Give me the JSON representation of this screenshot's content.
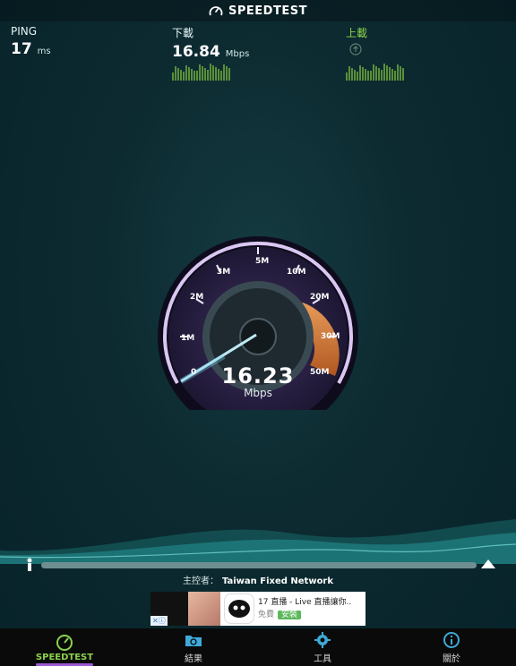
{
  "header": {
    "title": "SPEEDTEST"
  },
  "stats": {
    "ping": {
      "label": "PING",
      "value": "17",
      "unit": "ms"
    },
    "download": {
      "label": "下載",
      "value": "16.84",
      "unit": "Mbps"
    },
    "upload": {
      "label": "上載"
    }
  },
  "gauge": {
    "ticks": [
      "0",
      "1M",
      "2M",
      "3M",
      "5M",
      "10M",
      "20M",
      "30M",
      "50M"
    ],
    "value": "16.23",
    "unit": "Mbps"
  },
  "host": {
    "label": "主控者：",
    "name": "Taiwan Fixed Network"
  },
  "ad": {
    "title": "17 直播 - Live 直播讓你..",
    "free": "免費",
    "install": "安裝"
  },
  "nav": [
    {
      "label": "SPEEDTEST"
    },
    {
      "label": "結果"
    },
    {
      "label": "工具"
    },
    {
      "label": "關於"
    }
  ],
  "colors": {
    "accent_green": "#8bd14a",
    "accent_purple": "#9b59d0",
    "accent_orange": "#e07a2a"
  }
}
